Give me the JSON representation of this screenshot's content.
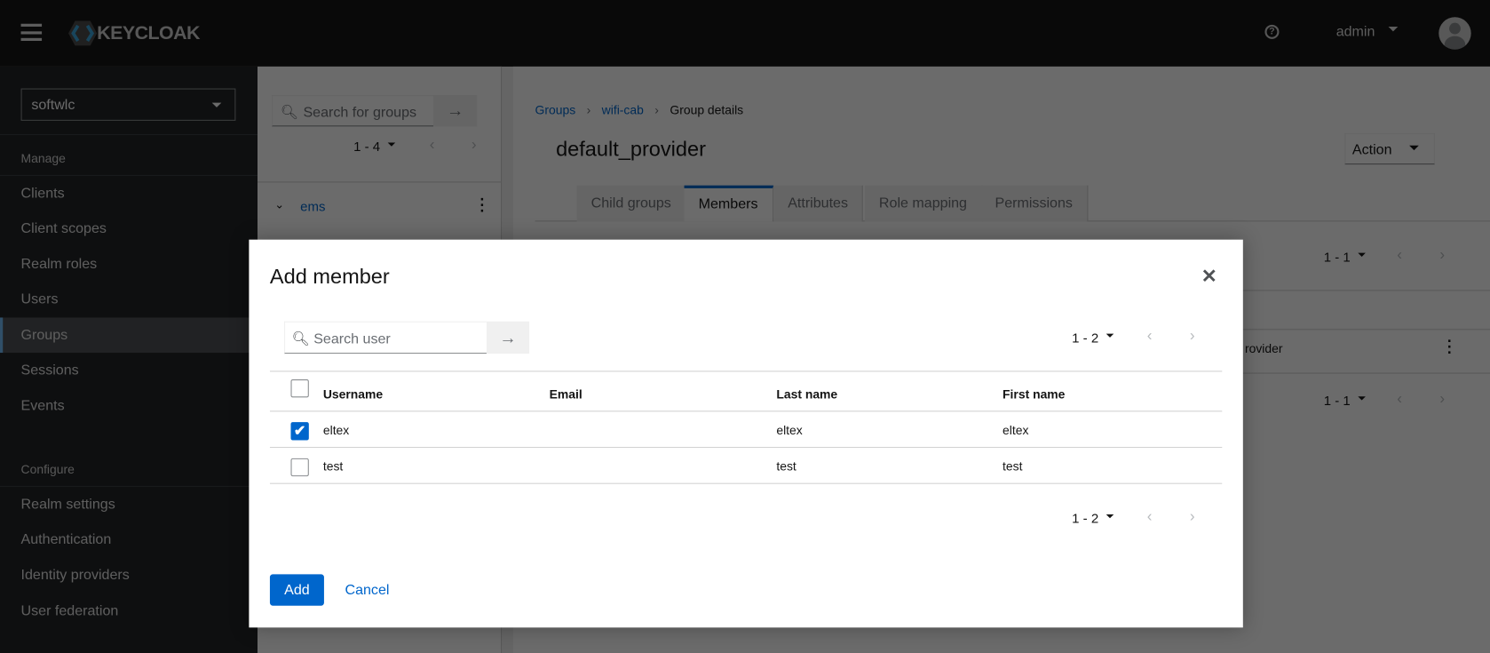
{
  "header": {
    "brand": "KEYCLOAK",
    "user": "admin"
  },
  "sidebar": {
    "realm": "softwlc",
    "manage_label": "Manage",
    "configure_label": "Configure",
    "manage_items": [
      "Clients",
      "Client scopes",
      "Realm roles",
      "Users",
      "Groups",
      "Sessions",
      "Events"
    ],
    "configure_items": [
      "Realm settings",
      "Authentication",
      "Identity providers",
      "User federation"
    ],
    "active": "Groups"
  },
  "groups_panel": {
    "search_placeholder": "Search for groups",
    "pagination": "1 - 4",
    "tree": [
      {
        "label": "ems"
      }
    ]
  },
  "main": {
    "breadcrumb": [
      "Groups",
      "wifi-cab",
      "Group details"
    ],
    "title": "default_provider",
    "action_label": "Action",
    "tabs": [
      "Child groups",
      "Members",
      "Attributes",
      "Role mapping",
      "Permissions"
    ],
    "active_tab": "Members",
    "pagination_top": "1 - 1",
    "pagination_bottom": "1 - 1",
    "row_partial": "rovider"
  },
  "modal": {
    "title": "Add member",
    "search_placeholder": "Search user",
    "pagination_top": "1 - 2",
    "pagination_bottom": "1 - 2",
    "columns": [
      "Username",
      "Email",
      "Last name",
      "First name"
    ],
    "rows": [
      {
        "username": "eltex",
        "email": "",
        "last_name": "eltex",
        "first_name": "eltex",
        "checked": true
      },
      {
        "username": "test",
        "email": "",
        "last_name": "test",
        "first_name": "test",
        "checked": false
      }
    ],
    "add_label": "Add",
    "cancel_label": "Cancel"
  },
  "colors": {
    "primary": "#0066cc",
    "header": "#151515",
    "sidebar": "#212427"
  }
}
